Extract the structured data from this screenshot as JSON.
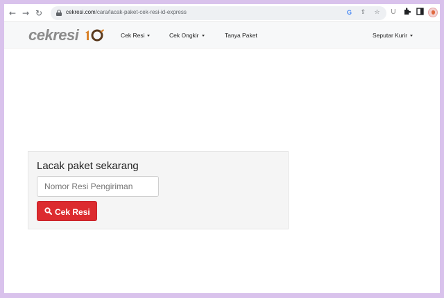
{
  "browser": {
    "url_domain": "cekresi.com",
    "url_path": "/cara/lacak-paket-cek-resi-id-express",
    "back_icon": "arrow-left-icon",
    "forward_icon": "arrow-right-icon",
    "reload_icon": "reload-icon",
    "extension_u_label": "U"
  },
  "site": {
    "logo_text": "cekresi",
    "logo_colors": {
      "gray": "#8b8b8b",
      "orange": "#d9822b",
      "brown": "#5a3a1e"
    },
    "nav": {
      "cek_resi": "Cek Resi",
      "cek_ongkir": "Cek Ongkir",
      "tanya_paket": "Tanya Paket",
      "seputar_kurir": "Seputar Kurir"
    }
  },
  "tracking": {
    "title": "Lacak paket sekarang",
    "input_placeholder": "Nomor Resi Pengiriman",
    "input_value": "",
    "button_label": "Cek Resi",
    "button_color": "#dc2b2f"
  }
}
